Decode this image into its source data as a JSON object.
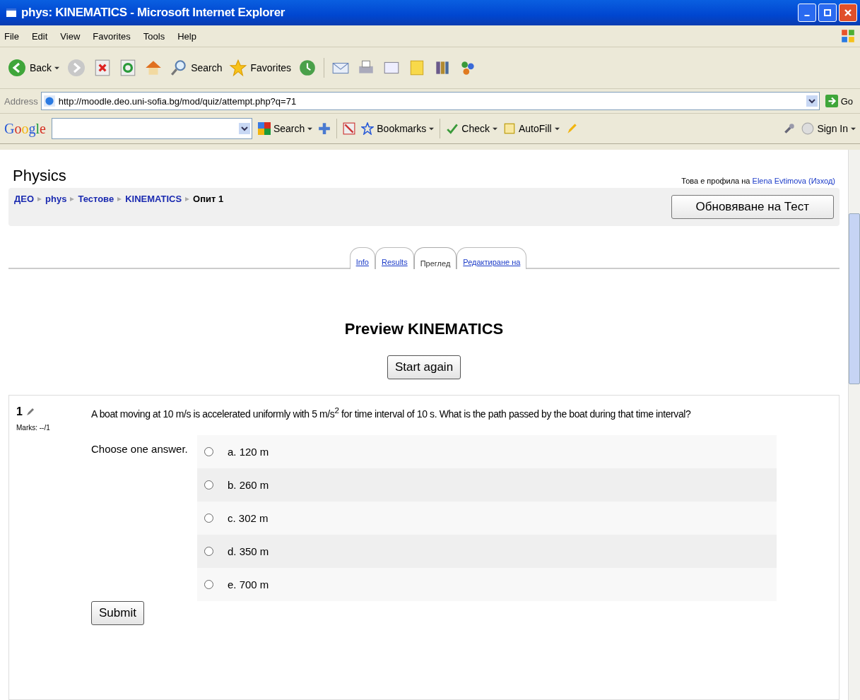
{
  "window": {
    "title": "phys: KINEMATICS - Microsoft Internet Explorer"
  },
  "menu": [
    "File",
    "Edit",
    "View",
    "Favorites",
    "Tools",
    "Help"
  ],
  "toolbar": {
    "back": "Back",
    "search": "Search",
    "favorites": "Favorites"
  },
  "address": {
    "label": "Address",
    "url": "http://moodle.deo.uni-sofia.bg/mod/quiz/attempt.php?q=71",
    "go": "Go"
  },
  "google_bar": {
    "logo": "Google",
    "search": "Search",
    "bookmarks": "Bookmarks",
    "check": "Check",
    "autofill": "AutoFill",
    "sign_in": "Sign In"
  },
  "page": {
    "site_title": "Physics",
    "user_info": {
      "prefix": "Това е профила на",
      "name": "Elena Evtimova",
      "logout": "(Изход)"
    },
    "breadcrumb": [
      {
        "label": "ДЕО",
        "link": true
      },
      {
        "label": "phys",
        "link": true
      },
      {
        "label": "Тестове",
        "link": true
      },
      {
        "label": "KINEMATICS",
        "link": true
      },
      {
        "label": "Опит 1",
        "link": false
      }
    ],
    "update_button": "Обновяване на Тест",
    "tabs": [
      {
        "label": "Info",
        "selected": false
      },
      {
        "label": "Results",
        "selected": false
      },
      {
        "label": "Преглед",
        "selected": true
      },
      {
        "label": "Редактиране на",
        "selected": false
      }
    ],
    "heading": "Preview KINEMATICS",
    "start_again": "Start again",
    "question": {
      "number": "1",
      "marks": "Marks: --/1",
      "text": "A boat moving at 10 m/s is accelerated uniformly with 5 m/s$^{2}$ for time interval of 10 s. What is the path passed by the boat during that time interval?",
      "prompt": "Choose one answer.",
      "options": [
        {
          "label": "a. 120 m",
          "selected": false
        },
        {
          "label": "b. 260 m",
          "selected": false
        },
        {
          "label": "c. 302 m",
          "selected": false
        },
        {
          "label": "d. 350 m",
          "selected": false
        },
        {
          "label": "e. 700 m",
          "selected": false
        }
      ],
      "submit": "Submit"
    }
  }
}
